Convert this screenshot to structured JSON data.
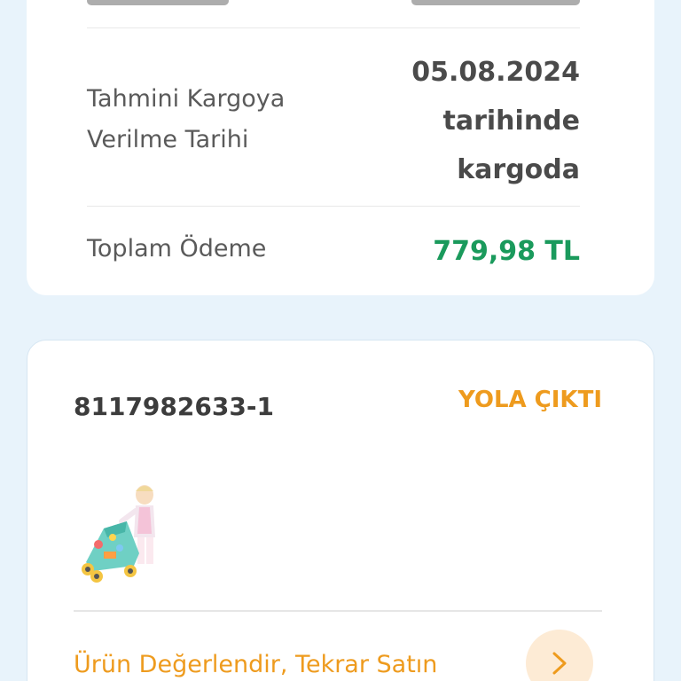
{
  "order_summary": {
    "estimated_shipping_label": "Tahmini Kargoya Verilme Tarihi",
    "estimated_shipping_value_lines": [
      "05.08.2024",
      "tarihinde",
      "kargoda"
    ],
    "total_label": "Toplam Ödeme",
    "total_value": "779,98 TL"
  },
  "order_card": {
    "order_number": "8117982633-1",
    "status": "YOLA ÇIKTI",
    "product_image": "baby-walker-product-photo",
    "action_text": "Ürün Değerlendir, Tekrar Satın",
    "action_icon": "chevron-right-icon"
  },
  "colors": {
    "background": "#e8f3fb",
    "status_orange": "#ee9b1e",
    "price_green": "#1a9a5c"
  }
}
